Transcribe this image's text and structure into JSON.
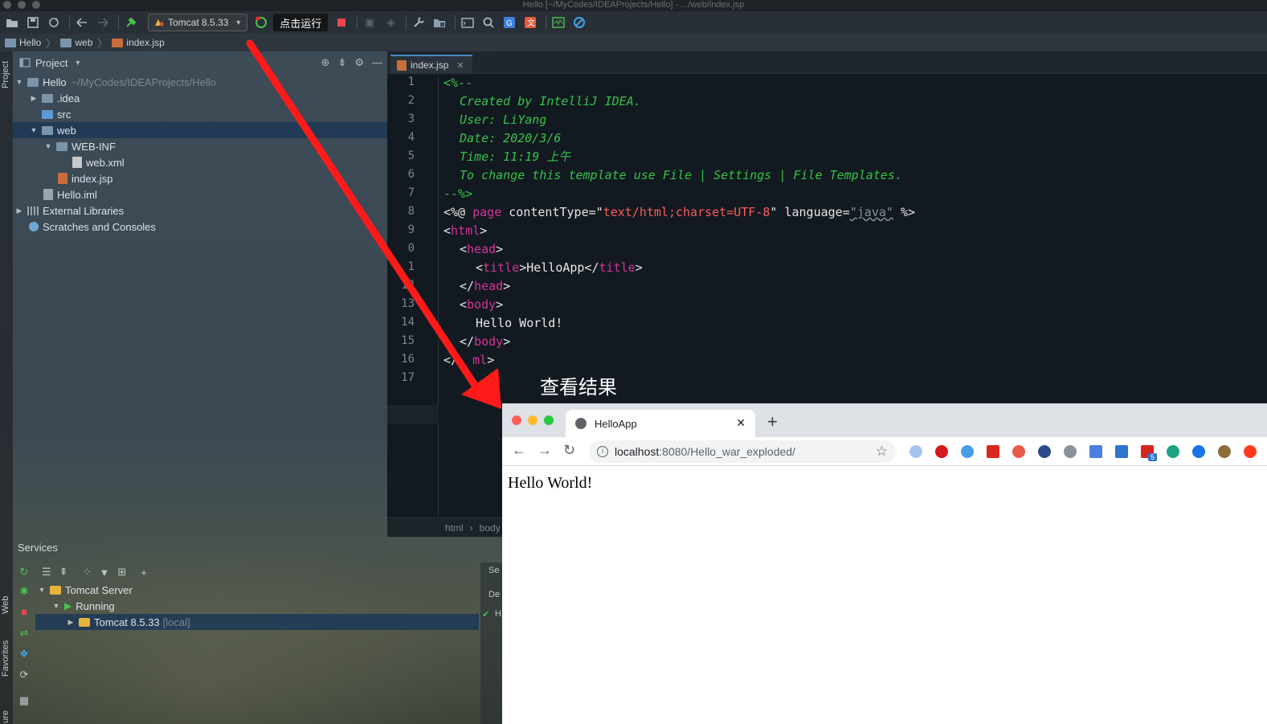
{
  "window": {
    "title": "Hello [~/MyCodes/IDEAProjects/Hello] - .../web/index.jsp"
  },
  "toolbar": {
    "run_config_label": "Tomcat 8.5.33",
    "run_tooltip": "点击运行"
  },
  "breadcrumbs": [
    {
      "label": "Hello"
    },
    {
      "label": "web"
    },
    {
      "label": "index.jsp"
    }
  ],
  "left_strip": {
    "project_label": "Project",
    "web_label": "Web",
    "favorites_label": "Favorites",
    "structure_label": "ure"
  },
  "project_panel": {
    "title": "Project",
    "tree": [
      {
        "label": "Hello",
        "extra": "~/MyCodes/IDEAProjects/Hello"
      },
      {
        "label": ".idea"
      },
      {
        "label": "src"
      },
      {
        "label": "web"
      },
      {
        "label": "WEB-INF"
      },
      {
        "label": "web.xml"
      },
      {
        "label": "index.jsp"
      },
      {
        "label": "Hello.iml"
      },
      {
        "label": "External Libraries"
      },
      {
        "label": "Scratches and Consoles"
      }
    ]
  },
  "editor": {
    "tab_label": "index.jsp",
    "line_numbers": [
      "1",
      "2",
      "3",
      "4",
      "5",
      "6",
      "7",
      "8",
      "9",
      "0",
      "1",
      "12",
      "13",
      "14",
      "15",
      "16",
      "17"
    ],
    "comment": {
      "open": "<%--",
      "created_by": "Created by IntelliJ IDEA.",
      "user": "User: LiYang",
      "date": "Date: 2020/3/6",
      "time": "Time: 11:19 上午",
      "change": "To change this template use File | Settings | File Templates.",
      "close": "--%>"
    },
    "directive": {
      "open": "<%@ ",
      "page": "page",
      "content_type_attr": " contentType=\"",
      "content_type_value": "text/html;charset=UTF-8",
      "language_attr": "\" language=",
      "language_value": "\"java\"",
      "close": " %>"
    },
    "tags": {
      "html_open": "html",
      "head_open": "head",
      "title_open": "title",
      "title_text": "HelloApp",
      "title_close": "title",
      "head_close": "head",
      "body_open": "body",
      "body_text": "Hello World!",
      "body_close": "body",
      "html_close_partial": "ml"
    },
    "status_crumbs": [
      "html",
      "body"
    ]
  },
  "services": {
    "title": "Services",
    "tree": [
      {
        "label": "Tomcat Server"
      },
      {
        "label": "Running"
      },
      {
        "label": "Tomcat 8.5.33",
        "extra": "[local]"
      }
    ],
    "right_tabs": [
      "Se",
      "De",
      "H"
    ]
  },
  "annotation": {
    "label": "查看结果"
  },
  "browser": {
    "tab_title": "HelloApp",
    "url_host": "localhost",
    "url_path": ":8080/Hello_war_exploded/",
    "page_text": "Hello World!",
    "extension_badge": "5"
  },
  "colors": {
    "accent_red": "#ff1a1a",
    "comment_green": "#34c34a",
    "tag_magenta": "#d4339a",
    "string_red": "#ff5a5a"
  }
}
